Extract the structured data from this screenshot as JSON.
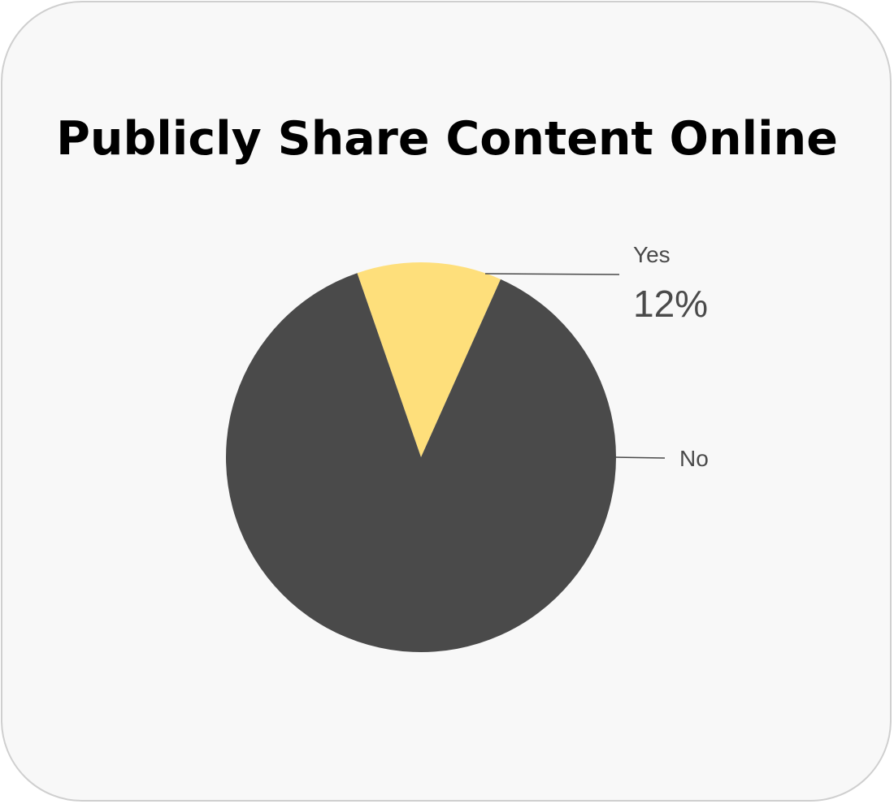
{
  "chart_data": {
    "type": "pie",
    "title": "Publicly Share Content Online",
    "slices": [
      {
        "label": "Yes",
        "value": 12,
        "value_label": "12%",
        "color": "#FEDF7B"
      },
      {
        "label": "No",
        "value": 88,
        "value_label": "",
        "color": "#4A4A4A"
      }
    ],
    "legend": "none",
    "label_style": "leader-lines"
  },
  "colors": {
    "card_background": "#F8F8F8",
    "card_border": "#CFCFCF",
    "leader_line": "#4A4A4A"
  }
}
